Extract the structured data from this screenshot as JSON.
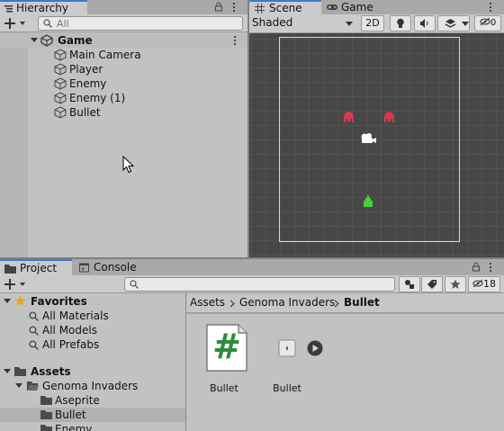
{
  "hierarchy": {
    "tab_label": "Hierarchy",
    "search_placeholder": "All",
    "scene_name": "Game",
    "items": [
      "Main Camera",
      "Player",
      "Enemy",
      "Enemy (1)",
      "Bullet"
    ]
  },
  "scene": {
    "tabs": [
      {
        "label": "Scene",
        "icon": "grid-icon"
      },
      {
        "label": "Game",
        "icon": "gamepad-icon"
      }
    ],
    "shading_mode": "Shaded",
    "mode_2d_label": "2D",
    "gizmo_count": "0",
    "sprites": [
      {
        "name": "enemy-sprite",
        "color": "#d23a4e"
      },
      {
        "name": "enemy-sprite",
        "color": "#d23a4e"
      },
      {
        "name": "camera-gizmo",
        "color": "#ffffff"
      },
      {
        "name": "player-sprite",
        "color": "#45d23a"
      }
    ]
  },
  "project": {
    "tabs": [
      {
        "label": "Project",
        "icon": "folder-icon"
      },
      {
        "label": "Console",
        "icon": "console-icon"
      }
    ],
    "hidden_count": "18",
    "favorites": {
      "label": "Favorites",
      "items": [
        "All Materials",
        "All Models",
        "All Prefabs"
      ]
    },
    "assets": {
      "label": "Assets",
      "children": [
        {
          "label": "Genoma Invaders",
          "children": [
            "Aseprite",
            "Bullet",
            "Enemy"
          ]
        }
      ]
    },
    "breadcrumb": [
      "Assets",
      "Genoma Invaders",
      "Bullet"
    ],
    "files": [
      {
        "label": "Bullet",
        "kind": "csharp-script",
        "glyph": "#"
      },
      {
        "label": "Bullet",
        "kind": "prefab"
      }
    ]
  },
  "colors": {
    "accent": "#3a79d6",
    "selection": "#b1b1b1",
    "scene_bg": "#474747",
    "script_green": "#2e8b3c"
  }
}
